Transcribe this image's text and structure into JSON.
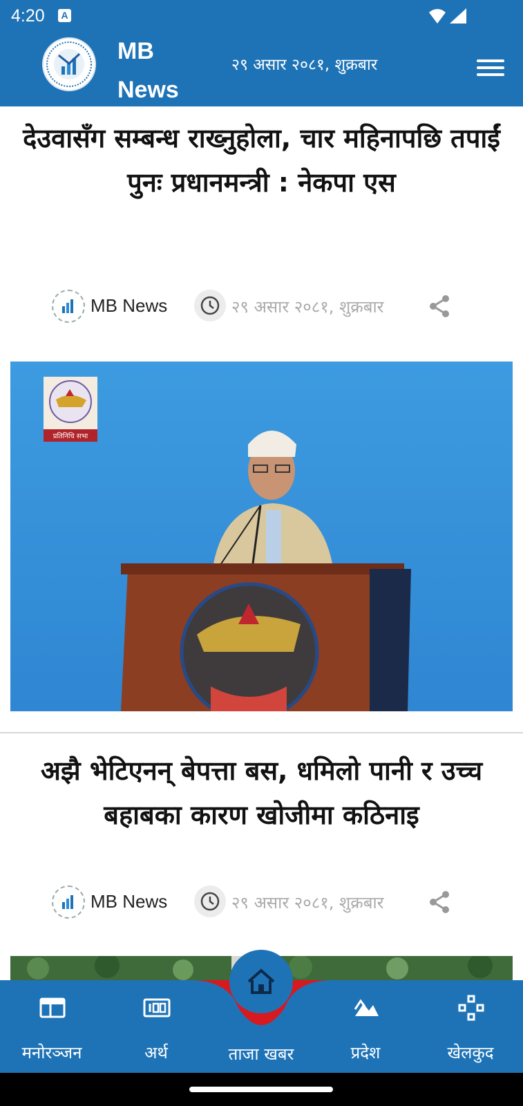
{
  "status_bar": {
    "time": "4:20",
    "notification_icon": "A"
  },
  "header": {
    "app_title_line1": "MB",
    "app_title_line2": "News",
    "date": "२९ असार २०८१, शुक्रबार",
    "menu_icon": "hamburger-icon"
  },
  "articles": [
    {
      "title": "देउवासँग सम्बन्ध राख्नुहोला, चार महिनापछि तपाईं पुनः प्रधानमन्त्री : नेकपा एस",
      "author": "MB News",
      "date": "२९ असार २०८१, शुक्रबार",
      "image_overlay_label": "प्रतिनिधि सभा"
    },
    {
      "title": "अझै भेटिएनन् बेपत्ता बस, धमिलो पानी र उच्च बहाबका कारण खोजीमा कठिनाइ",
      "author": "MB News",
      "date": "२९ असार २०८१, शुक्रबार"
    }
  ],
  "bottom_nav": {
    "items": [
      {
        "label": "मनोरञ्जन",
        "icon": "entertainment-icon"
      },
      {
        "label": "अर्थ",
        "icon": "economy-icon"
      },
      {
        "label": "ताजा खबर",
        "icon": "home-icon",
        "active": true
      },
      {
        "label": "प्रदेश",
        "icon": "province-icon"
      },
      {
        "label": "खेलकुद",
        "icon": "sports-icon"
      }
    ]
  },
  "colors": {
    "primary": "#1e73b7",
    "accent_red": "#d71920",
    "meta_gray": "#aaaaaa"
  }
}
